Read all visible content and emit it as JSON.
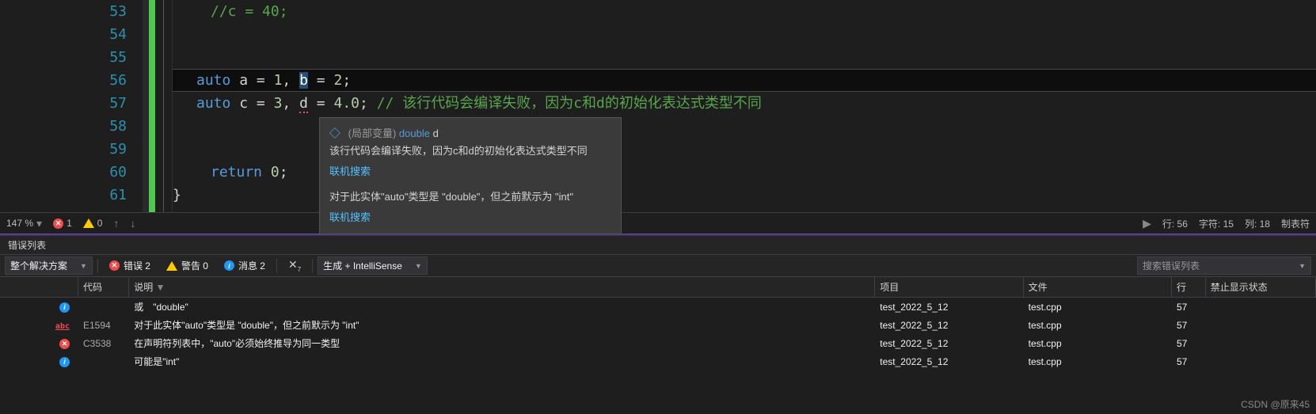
{
  "editor": {
    "lines": [
      {
        "num": "53",
        "html": "<span class='cm'>//c = 40;</span>"
      },
      {
        "num": "54",
        "html": ""
      },
      {
        "num": "55",
        "html": ""
      },
      {
        "num": "56",
        "html": "<span class='kw'>auto</span> <span class='var'>a</span> <span class='op'>=</span> <span class='num'>1</span><span class='op'>,</span> <span class='sel'>b</span> <span class='op'>=</span> <span class='num'>2</span><span class='op'>;</span>"
      },
      {
        "num": "57",
        "html": "<span class='kw'>auto</span> <span class='var'>c</span> <span class='op'>=</span> <span class='num'>3</span><span class='op'>,</span> <span class='var underline'>d</span> <span class='op'>=</span> <span class='num'>4.0</span><span class='op'>;</span> <span class='cm'>// 该行代码会编译失败，因为c和d的初始化表达式类型不同</span>"
      },
      {
        "num": "58",
        "html": ""
      },
      {
        "num": "59",
        "html": ""
      },
      {
        "num": "60",
        "html": "<span class='kw'>return</span> <span class='num'>0</span><span class='op'>;</span>"
      },
      {
        "num": "61",
        "html": "<span class='brace'>}</span>"
      }
    ]
  },
  "tooltip": {
    "scope_label": "(局部变量)",
    "type": "double",
    "name": "d",
    "desc1": "该行代码会编译失败，因为c和d的初始化表达式类型不同",
    "link": "联机搜索",
    "desc2": "对于此实体\"auto\"类型是 \"double\"，但之前默示为 \"int\""
  },
  "status": {
    "zoom": "147 %",
    "err_count": "1",
    "warn_count": "0",
    "line_label": "行:",
    "line_val": "56",
    "char_label": "字符:",
    "char_val": "15",
    "col_label": "列:",
    "col_val": "18",
    "ins": "制表符"
  },
  "panel": {
    "title": "错误列表",
    "scope": "整个解决方案",
    "errors": "错误 2",
    "warnings": "警告 0",
    "messages": "消息 2",
    "build": "生成 + IntelliSense",
    "search_placeholder": "搜索错误列表"
  },
  "columns": {
    "code": "代码",
    "desc": "说明",
    "sort": "▼",
    "project": "项目",
    "file": "文件",
    "line": "行",
    "suppress": "禁止显示状态"
  },
  "errors": [
    {
      "icon": "info",
      "code": "",
      "desc": "或　\"double\"",
      "proj": "test_2022_5_12",
      "file": "test.cpp",
      "line": "57"
    },
    {
      "icon": "abc",
      "code": "E1594",
      "desc": "对于此实体\"auto\"类型是 \"double\"，但之前默示为 \"int\"",
      "proj": "test_2022_5_12",
      "file": "test.cpp",
      "line": "57"
    },
    {
      "icon": "err",
      "code": "C3538",
      "desc": "在声明符列表中，\"auto\"必须始终推导为同一类型",
      "proj": "test_2022_5_12",
      "file": "test.cpp",
      "line": "57"
    },
    {
      "icon": "info",
      "code": "",
      "desc": "可能是\"int\"",
      "proj": "test_2022_5_12",
      "file": "test.cpp",
      "line": "57"
    }
  ],
  "watermark": "CSDN @原来45"
}
